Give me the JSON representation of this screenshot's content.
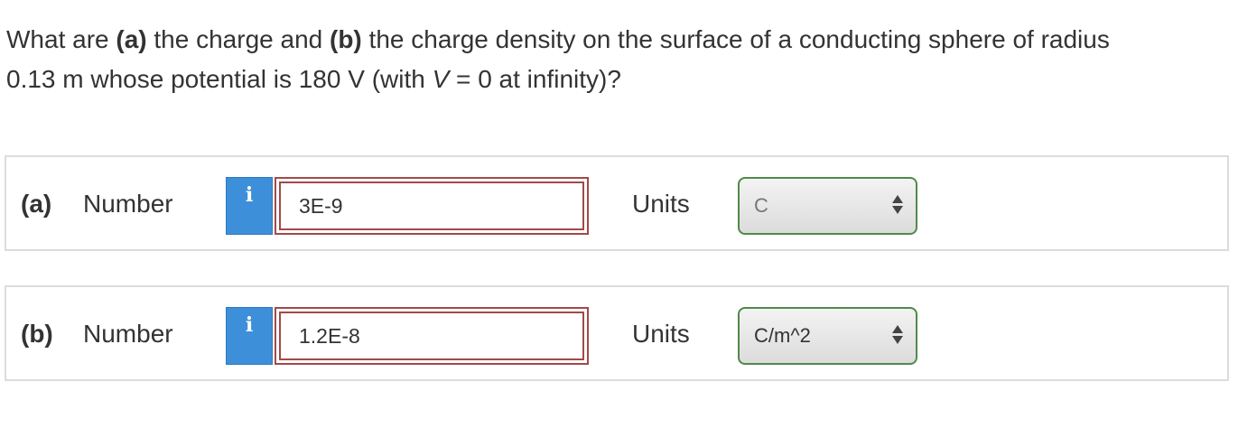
{
  "question": {
    "line1_pre": "What are ",
    "part_a": "(a)",
    "line1_mid": " the charge and ",
    "part_b": "(b)",
    "line1_post": " the charge density on the surface of a conducting sphere of radius",
    "line2_pre": "0.13 m whose potential is 180 V (with ",
    "var_v": "V",
    "line2_post": " = 0 at infinity)?"
  },
  "rows": [
    {
      "part_label": "(a)",
      "number_label": "Number",
      "info_icon": "i",
      "answer": "3E-9",
      "units_label": "Units",
      "unit_selected": "C"
    },
    {
      "part_label": "(b)",
      "number_label": "Number",
      "info_icon": "i",
      "answer": "1.2E-8",
      "units_label": "Units",
      "unit_selected": "C/m^2"
    }
  ],
  "colors": {
    "info_button": "#3d8fd9",
    "answer_border": "#a24a47",
    "select_border": "#4f8a4a",
    "row_border": "#dcdcdc",
    "text": "#333333"
  },
  "icons": {
    "info": "info-icon",
    "select_arrows": "up-down-arrows-icon"
  }
}
